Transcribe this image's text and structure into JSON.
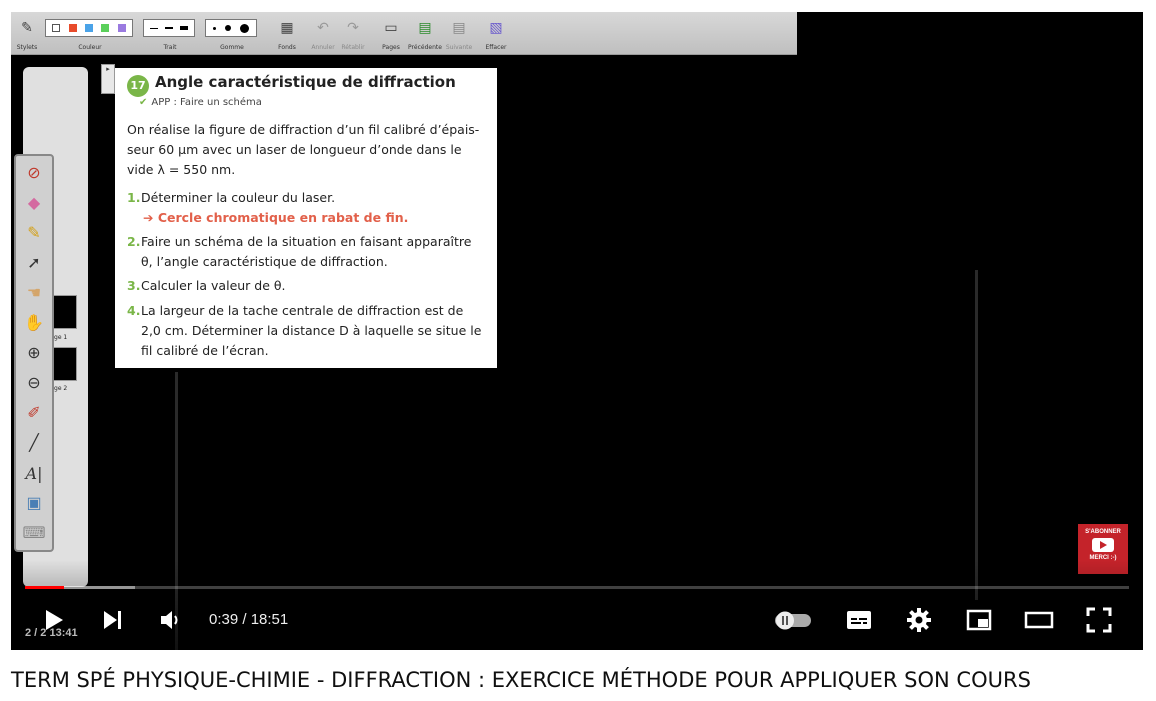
{
  "toolbar": {
    "groups": [
      {
        "label": "Stylets",
        "icon": "stylus-icon"
      },
      {
        "label": "Couleur"
      },
      {
        "label": "Trait"
      },
      {
        "label": "Gomme"
      },
      {
        "label": "Fonds",
        "icon": "background-icon"
      },
      {
        "label": "Annuler",
        "icon": "undo-icon"
      },
      {
        "label": "Rétablir",
        "icon": "redo-icon"
      },
      {
        "label": "Pages",
        "icon": "pages-icon"
      },
      {
        "label": "Précédente",
        "icon": "previous-page-icon"
      },
      {
        "label": "Suivante",
        "icon": "next-page-icon"
      },
      {
        "label": "Effacer",
        "icon": "erase-all-icon"
      }
    ],
    "colors": [
      "#ffffff",
      "#e84b2b",
      "#4aa3e8",
      "#5bd05b",
      "#9a7ae0"
    ]
  },
  "side_panel": {
    "thumbnails": [
      {
        "label": "Page 1"
      },
      {
        "label": "Page 2"
      }
    ]
  },
  "exercise": {
    "number": "17",
    "title": "Angle caractéristique de diffraction",
    "tag": "APP : Faire un schéma",
    "intro": "On réalise la figure de diffraction d’un fil calibré d’épais-seur 60 µm avec un laser de longueur d’onde dans le vide λ = 550 nm.",
    "questions": [
      {
        "n": "1.",
        "text": "Déterminer la couleur du laser.",
        "hint": "➔ Cercle chromatique en rabat de fin."
      },
      {
        "n": "2.",
        "text": "Faire un schéma de la situation en faisant apparaître θ, l’angle caractéristique de diffraction."
      },
      {
        "n": "3.",
        "text": "Calculer la valeur de θ."
      },
      {
        "n": "4.",
        "text": "La largeur de la tache centrale de diffraction est de 2,0 cm. Déterminer la distance D à laquelle se situe le fil calibré de l’écran."
      }
    ]
  },
  "subscribe": {
    "line1": "S'ABONNER",
    "line2": "MERCI :-)"
  },
  "player": {
    "time": "0:39 / 18:51",
    "progress_fraction": 0.035,
    "buffer_fraction": 0.1,
    "overlay_page": "2 / 2  13:41"
  },
  "video": {
    "title": "TERM SPÉ PHYSIQUE-CHIMIE - DIFFRACTION : EXERCICE MÉTHODE POUR APPLIQUER SON COURS"
  }
}
